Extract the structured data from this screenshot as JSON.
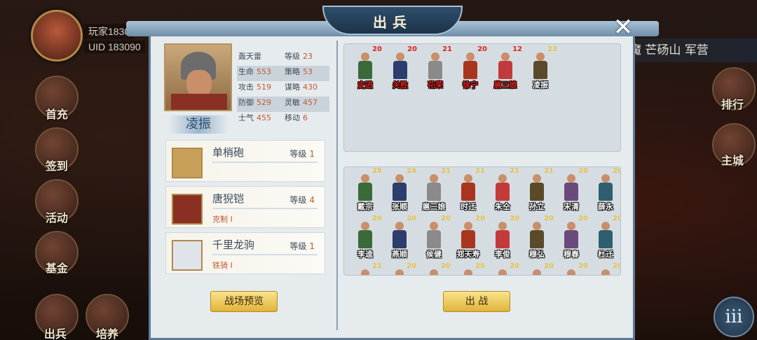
{
  "player": {
    "name": "玩家1830",
    "uid": "UID 183090"
  },
  "side_menu": {
    "items": [
      {
        "label": "首充"
      },
      {
        "label": "签到"
      },
      {
        "label": "活动"
      },
      {
        "label": "基金"
      },
      {
        "label": "出兵"
      },
      {
        "label": "培养"
      }
    ]
  },
  "right_menu": {
    "banner": "魔 芒砀山 军营",
    "items": [
      {
        "label": "排行"
      },
      {
        "label": "主城"
      }
    ]
  },
  "menu_button": {
    "label": "iii"
  },
  "modal": {
    "title": "出兵",
    "close_label": "✕",
    "hero": {
      "name": "凌振",
      "stats": [
        {
          "label": "轰天雷",
          "value": ""
        },
        {
          "label": "等级",
          "value": "23"
        },
        {
          "label": "生命",
          "value": "553"
        },
        {
          "label": "策略",
          "value": "53"
        },
        {
          "label": "攻击",
          "value": "519"
        },
        {
          "label": "谋略",
          "value": "430"
        },
        {
          "label": "防御",
          "value": "529"
        },
        {
          "label": "灵敏",
          "value": "457"
        },
        {
          "label": "士气",
          "value": "455"
        },
        {
          "label": "移动",
          "value": "6"
        }
      ]
    },
    "equipment": [
      {
        "name": "单梢砲",
        "level_label": "等级",
        "level": "1",
        "trait": ""
      },
      {
        "name": "唐猊铠",
        "level_label": "等级",
        "level": "4",
        "trait": "克制 I"
      },
      {
        "name": "千里龙驹",
        "level_label": "等级",
        "level": "1",
        "trait": "铁骑 I"
      }
    ],
    "preview_button": "战场预览",
    "battle_button": "出 战",
    "deployed": [
      {
        "name": "史进",
        "level": "20"
      },
      {
        "name": "关胜",
        "level": "20"
      },
      {
        "name": "花荣",
        "level": "21"
      },
      {
        "name": "徐宁",
        "level": "20"
      },
      {
        "name": "扈三娘",
        "level": "12"
      },
      {
        "name": "凌振",
        "level": "23"
      }
    ],
    "roster": [
      {
        "name": "戴宗",
        "level": "25"
      },
      {
        "name": "张顺",
        "level": "24"
      },
      {
        "name": "扈三娘",
        "level": "21"
      },
      {
        "name": "时迁",
        "level": "21"
      },
      {
        "name": "朱仝",
        "level": "21"
      },
      {
        "name": "孙立",
        "level": "21"
      },
      {
        "name": "宋清",
        "level": "20"
      },
      {
        "name": "薛永",
        "level": "20"
      },
      {
        "name": "李逵",
        "level": "20"
      },
      {
        "name": "燕顺",
        "level": "20"
      },
      {
        "name": "侯健",
        "level": "20"
      },
      {
        "name": "郑天寿",
        "level": "20"
      },
      {
        "name": "李俊",
        "level": "20"
      },
      {
        "name": "穆弘",
        "level": "20"
      },
      {
        "name": "穆春",
        "level": "20"
      },
      {
        "name": "杜迁",
        "level": "20"
      },
      {
        "name": "",
        "level": "21"
      },
      {
        "name": "",
        "level": "20"
      },
      {
        "name": "",
        "level": "20"
      },
      {
        "name": "",
        "level": "20"
      },
      {
        "name": "",
        "level": "20"
      },
      {
        "name": "",
        "level": "20"
      },
      {
        "name": "",
        "level": "20"
      },
      {
        "name": "",
        "level": "20"
      }
    ]
  },
  "colors": {
    "level_red": "#e0201a",
    "level_gold": "#e6c24a",
    "stat_value": "#c05a32",
    "panel_blue": "#5c7a95",
    "button_gold": "#e0b43a"
  }
}
